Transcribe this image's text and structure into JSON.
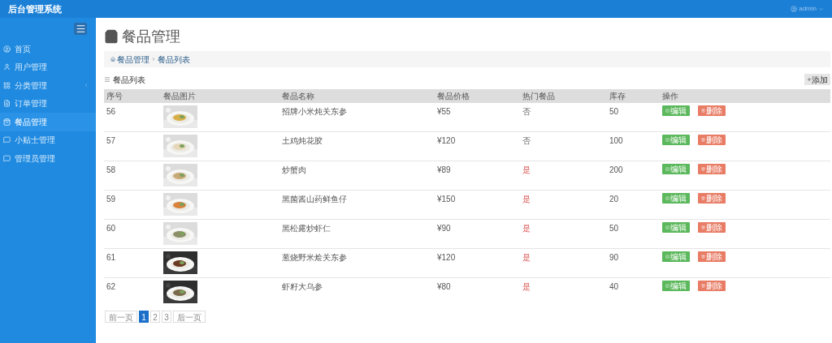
{
  "header": {
    "title": "后台管理系统",
    "user": "admin"
  },
  "sidebar": {
    "items": [
      {
        "label": "首页",
        "selected": false,
        "has_children": false
      },
      {
        "label": "用户管理",
        "selected": false,
        "has_children": false
      },
      {
        "label": "分类管理",
        "selected": false,
        "has_children": true
      },
      {
        "label": "订单管理",
        "selected": false,
        "has_children": false
      },
      {
        "label": "餐品管理",
        "selected": true,
        "has_children": false
      },
      {
        "label": "小贴士管理",
        "selected": false,
        "has_children": false
      },
      {
        "label": "管理员管理",
        "selected": false,
        "has_children": false
      }
    ]
  },
  "page": {
    "title": "餐品管理",
    "breadcrumb": [
      "餐品管理",
      "餐品列表"
    ],
    "list_title": "餐品列表",
    "add_button": "添加"
  },
  "table": {
    "columns": [
      "序号",
      "餐品图片",
      "餐品名称",
      "餐品价格",
      "热门餐品",
      "库存",
      "操作"
    ],
    "rows": [
      {
        "id": "56",
        "image": {
          "kind": "picture"
        },
        "name": "招牌小米炖关东参",
        "price": "¥55",
        "hot_label": "否",
        "hot": false,
        "stock": "50",
        "actions": [
          "编辑",
          "删除"
        ]
      },
      {
        "id": "57",
        "image": {
          "kind": "picture"
        },
        "name": "土鸡炖花胶",
        "price": "¥120",
        "hot_label": "否",
        "hot": false,
        "stock": "100",
        "actions": [
          "编辑",
          "删除"
        ]
      },
      {
        "id": "58",
        "image": {
          "kind": "picture"
        },
        "name": "炒蟹肉",
        "price": "¥89",
        "hot_label": "是",
        "hot": true,
        "stock": "200",
        "actions": [
          "编辑",
          "删除"
        ]
      },
      {
        "id": "59",
        "image": {
          "kind": "picture"
        },
        "name": "黑菌酱山药鲜鱼仔",
        "price": "¥150",
        "hot_label": "是",
        "hot": true,
        "stock": "20",
        "actions": [
          "编辑",
          "删除"
        ]
      },
      {
        "id": "60",
        "image": {
          "kind": "picture"
        },
        "name": "黑松露炒虾仁",
        "price": "¥90",
        "hot_label": "是",
        "hot": true,
        "stock": "50",
        "actions": [
          "编辑",
          "删除"
        ]
      },
      {
        "id": "61",
        "image": {
          "kind": "picture"
        },
        "name": "葱烧野米烩关东参",
        "price": "¥120",
        "hot_label": "是",
        "hot": true,
        "stock": "90",
        "actions": [
          "编辑",
          "删除"
        ]
      },
      {
        "id": "62",
        "image": {
          "kind": "picture"
        },
        "name": "虾籽大乌参",
        "price": "¥80",
        "hot_label": "是",
        "hot": true,
        "stock": "40",
        "actions": [
          "编辑",
          "删除"
        ]
      }
    ]
  },
  "pagination": {
    "prev": "前一页",
    "pages": [
      {
        "label": "1",
        "selected": true
      },
      {
        "label": "2",
        "selected": false
      },
      {
        "label": "3",
        "selected": false
      }
    ],
    "next": "后一页"
  }
}
